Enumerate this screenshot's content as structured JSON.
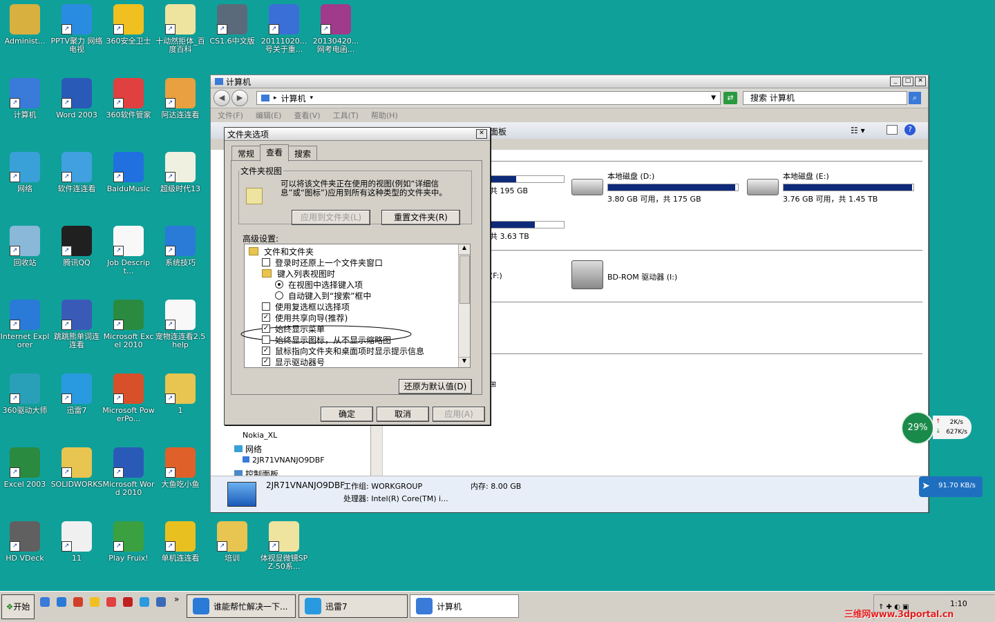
{
  "desktop_icons": [
    {
      "label": "Administ...",
      "color": "#d8b040",
      "icon": "user-folder-icon"
    },
    {
      "label": "PPTV聚力 网络电视",
      "color": "#2a8ce0",
      "icon": "pptv-icon"
    },
    {
      "label": "360安全卫士",
      "color": "#f0c020",
      "icon": "360-safe-icon"
    },
    {
      "label": "十动然拒体_百度百科",
      "color": "#efe3a0",
      "icon": "document-icon"
    },
    {
      "label": "CS1.6中文版",
      "color": "#5a6a7a",
      "icon": "cs-icon"
    },
    {
      "label": "20111020...号关于重...",
      "color": "#3a6fd8",
      "icon": "word-doc-icon"
    },
    {
      "label": "20130420...网考电函...",
      "color": "#a03a8a",
      "icon": "winrar-icon"
    },
    {
      "label": "计算机",
      "color": "#3a7ad8",
      "icon": "computer-icon"
    },
    {
      "label": "Word 2003",
      "color": "#2a5ab8",
      "icon": "word-icon"
    },
    {
      "label": "360软件管家",
      "color": "#e04040",
      "icon": "360-software-icon"
    },
    {
      "label": "阿达连连看",
      "color": "#e8a040",
      "icon": "game-icon"
    },
    {
      "label": "网络",
      "color": "#3aa0d8",
      "icon": "network-icon"
    },
    {
      "label": "软件连连看",
      "color": "#40a0e0",
      "icon": "game-icon"
    },
    {
      "label": "BaiduMusic",
      "color": "#2070e0",
      "icon": "baidu-music-icon"
    },
    {
      "label": "超级时代13",
      "color": "#f0f0e0",
      "icon": "document-icon"
    },
    {
      "label": "回收站",
      "color": "#8ab8d8",
      "icon": "recycle-bin-icon"
    },
    {
      "label": "腾讯QQ",
      "color": "#202020",
      "icon": "qq-icon"
    },
    {
      "label": "Job Descript...",
      "color": "#f8f8f8",
      "icon": "document-icon"
    },
    {
      "label": "系统技巧",
      "color": "#2a7ad8",
      "icon": "ie-icon"
    },
    {
      "label": "Internet Explorer",
      "color": "#2a7ad8",
      "icon": "ie-icon"
    },
    {
      "label": "跳跳熊单词连连看",
      "color": "#3a5ab8",
      "icon": "bear-icon"
    },
    {
      "label": "Microsoft Excel 2010",
      "color": "#2a8a40",
      "icon": "excel-icon"
    },
    {
      "label": "宠物连连看2.5help",
      "color": "#f8f8f8",
      "icon": "document-icon"
    },
    {
      "label": "360驱动大师",
      "color": "#2aa0b8",
      "icon": "driver-icon"
    },
    {
      "label": "迅雷7",
      "color": "#2a9ae0",
      "icon": "thunder-icon"
    },
    {
      "label": "Microsoft PowerPo...",
      "color": "#d8502a",
      "icon": "powerpoint-icon"
    },
    {
      "label": "1",
      "color": "#e8c450",
      "icon": "folder-icon"
    },
    {
      "label": "Excel 2003",
      "color": "#2a8a40",
      "icon": "excel-icon"
    },
    {
      "label": "SOLIDWORKS",
      "color": "#e8c450",
      "icon": "folder-icon"
    },
    {
      "label": "Microsoft Word 2010",
      "color": "#2a5ab8",
      "icon": "word-icon"
    },
    {
      "label": "大鱼吃小鱼",
      "color": "#e0602a",
      "icon": "fish-icon"
    },
    {
      "label": "HD VDeck",
      "color": "#606060",
      "icon": "vdeck-icon"
    },
    {
      "label": "11",
      "color": "#f0f0f0",
      "icon": "document-icon"
    },
    {
      "label": "Play Fruix!",
      "color": "#3aa040",
      "icon": "game-icon"
    },
    {
      "label": "单机连连看",
      "color": "#e8c020",
      "icon": "game-icon"
    },
    {
      "label": "培训",
      "color": "#e8c450",
      "icon": "folder-icon"
    },
    {
      "label": "体视显微镜SPZ-50系...",
      "color": "#efe3a0",
      "icon": "document-icon"
    }
  ],
  "explorer": {
    "title": "计算机",
    "address": "计算机",
    "search_placeholder": "搜索 计算机",
    "menu": [
      "文件(F)",
      "编辑(E)",
      "查看(V)",
      "工具(T)",
      "帮助(H)"
    ],
    "cmdbar_fragment": "面板",
    "drives": [
      {
        "name": "",
        "free": "共 195 GB",
        "fill": 0.35
      },
      {
        "name": "本地磁盘 (D:)",
        "free": "3.80 GB 可用，共 175 GB",
        "fill": 0.98
      },
      {
        "name": "本地磁盘 (E:)",
        "free": "3.76 GB 可用，共 1.45 TB",
        "fill": 0.99
      },
      {
        "name": "",
        "free": "共 3.63 TB",
        "fill": 0.6
      }
    ],
    "removable": [
      {
        "name": "(F:)"
      },
      {
        "name": "BD-ROM 驱动器 (I:)"
      }
    ],
    "tree": [
      "Nokia_XL",
      "网络",
      "2JR71VNANJO9DBF",
      "控制面板"
    ],
    "details": {
      "computer": "2JR71VNANJO9DBF",
      "workgroup_label": "工作组:",
      "workgroup": "WORKGROUP",
      "memory_label": "内存:",
      "memory": "8.00 GB",
      "cpu_label": "处理器:",
      "cpu": "Intel(R) Core(TM) i..."
    }
  },
  "dialog": {
    "title": "文件夹选项",
    "tabs": [
      "常规",
      "查看",
      "搜索"
    ],
    "folder_view_legend": "文件夹视图",
    "folder_view_text": "可以将该文件夹正在使用的视图(例如“详细信息”或“图标”)应用到所有这种类型的文件夹中。",
    "apply_to_folders": "应用到文件夹(L)",
    "reset_folders": "重置文件夹(R)",
    "advanced_label": "高级设置:",
    "items": [
      {
        "type": "folder",
        "label": "文件和文件夹",
        "indent": 0
      },
      {
        "type": "check",
        "label": "登录时还原上一个文件夹窗口",
        "checked": false,
        "indent": 1
      },
      {
        "type": "folder",
        "label": "键入列表视图时",
        "indent": 1
      },
      {
        "type": "radio",
        "label": "在视图中选择键入项",
        "checked": true,
        "indent": 2
      },
      {
        "type": "radio",
        "label": "自动键入到“搜索”框中",
        "checked": false,
        "indent": 2
      },
      {
        "type": "check",
        "label": "使用复选框以选择项",
        "checked": false,
        "indent": 1
      },
      {
        "type": "check",
        "label": "使用共享向导(推荐)",
        "checked": true,
        "indent": 1
      },
      {
        "type": "check",
        "label": "始终显示菜单",
        "checked": true,
        "indent": 1
      },
      {
        "type": "check",
        "label": "始终显示图标，从不显示缩略图",
        "checked": false,
        "indent": 1
      },
      {
        "type": "check",
        "label": "鼠标指向文件夹和桌面项时显示提示信息",
        "checked": true,
        "indent": 1
      },
      {
        "type": "check",
        "label": "显示驱动器号",
        "checked": true,
        "indent": 1
      }
    ],
    "restore_defaults": "还原为默认值(D)",
    "ok": "确定",
    "cancel": "取消",
    "apply": "应用(A)"
  },
  "taskbar": {
    "start": "开始",
    "tasks": [
      {
        "label": "谁能帮忙解决一下...",
        "icon": "ie-icon"
      },
      {
        "label": "迅雷7",
        "icon": "thunder-icon"
      },
      {
        "label": "计算机",
        "icon": "computer-icon",
        "active": true
      }
    ],
    "overflow": "»",
    "clock": "1:10",
    "watermark": "三维网www.3dportal.cn"
  },
  "gadgets": {
    "net_percent": "29%",
    "up_speed": "2K/s",
    "down_speed": "627K/s",
    "download_rate": "91.70 KB/s"
  }
}
